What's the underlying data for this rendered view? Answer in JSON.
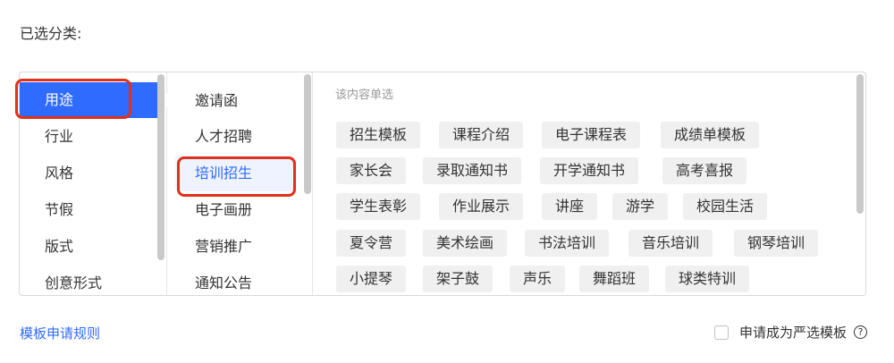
{
  "selected_label": "已选分类:",
  "column1": {
    "items": [
      "用途",
      "行业",
      "风格",
      "节假",
      "版式",
      "创意形式"
    ],
    "active": "用途"
  },
  "column2": {
    "items": [
      "邀请函",
      "人才招聘",
      "培训招生",
      "电子画册",
      "营销推广",
      "通知公告"
    ],
    "active": "培训招生"
  },
  "column3": {
    "hint": "该内容单选",
    "tags": [
      [
        "招生模板",
        "课程介绍",
        "电子课程表",
        "成绩单模板"
      ],
      [
        "家长会",
        "录取通知书",
        "开学通知书",
        "高考喜报"
      ],
      [
        "学生表彰",
        "作业展示",
        "讲座",
        "游学",
        "校园生活"
      ],
      [
        "夏令营",
        "美术绘画",
        "书法培训",
        "音乐培训",
        "钢琴培训"
      ],
      [
        "小提琴",
        "架子鼓",
        "声乐",
        "舞蹈班",
        "球类特训"
      ]
    ]
  },
  "footer": {
    "rules_link": "模板申请规则",
    "apply_label": "申请成为严选模板",
    "help_icon": "?"
  },
  "colors": {
    "accent": "#2f6bff",
    "highlight": "#e0311a",
    "tag_bg": "#f0f0f0"
  }
}
